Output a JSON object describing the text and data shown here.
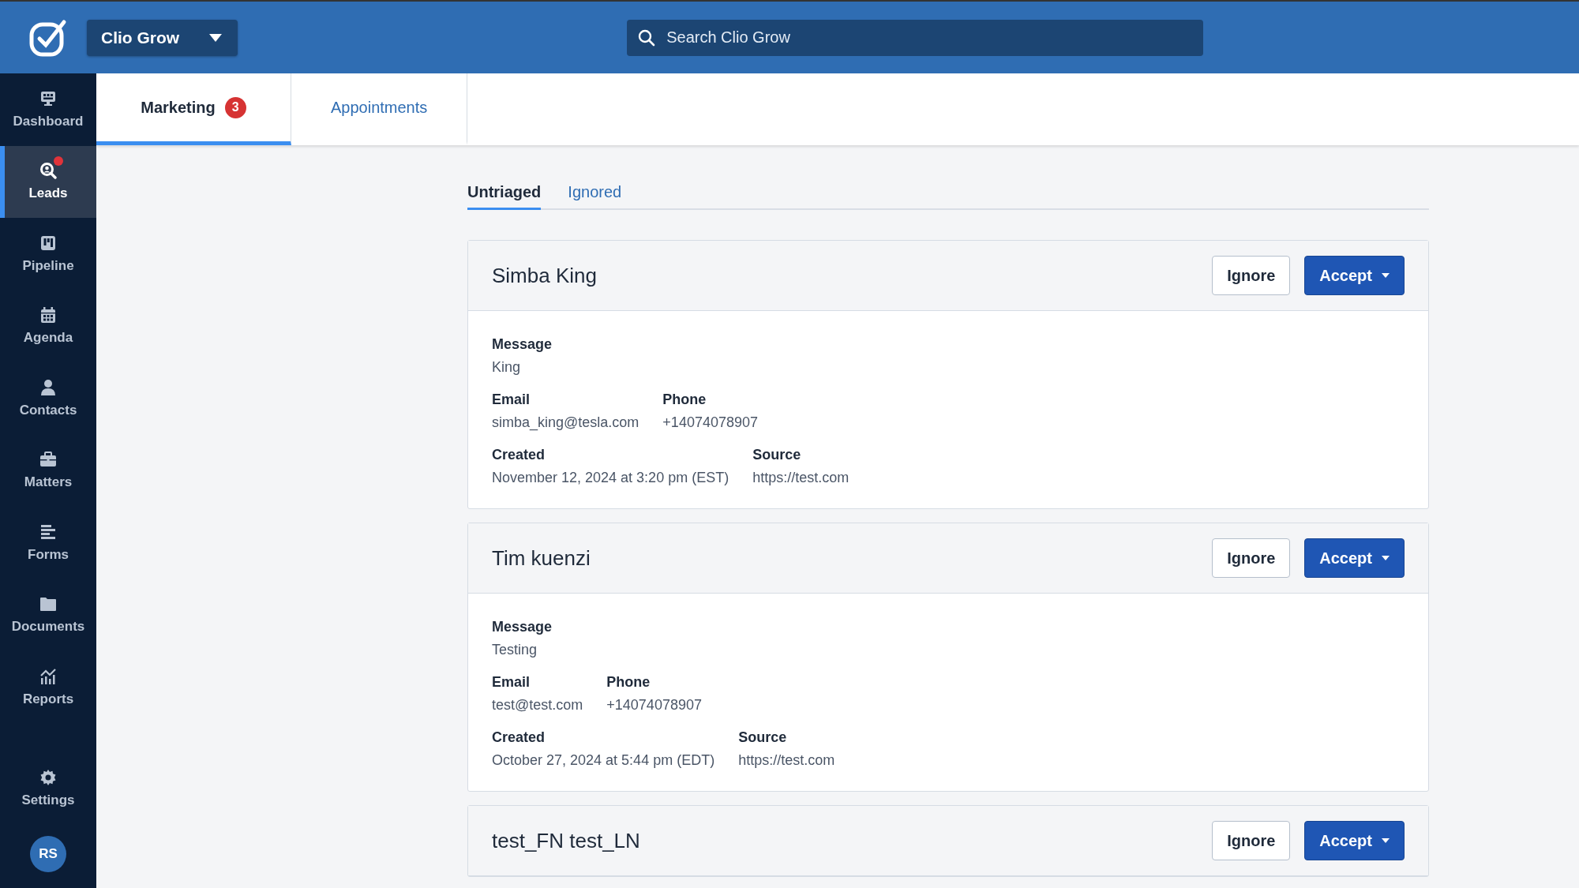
{
  "app": {
    "name": "Clio Grow"
  },
  "search": {
    "placeholder": "Search Clio Grow"
  },
  "sidebar": {
    "items": [
      {
        "label": "Dashboard",
        "selected": false,
        "alert": false
      },
      {
        "label": "Leads",
        "selected": true,
        "alert": true
      },
      {
        "label": "Pipeline",
        "selected": false,
        "alert": false
      },
      {
        "label": "Agenda",
        "selected": false,
        "alert": false
      },
      {
        "label": "Contacts",
        "selected": false,
        "alert": false
      },
      {
        "label": "Matters",
        "selected": false,
        "alert": false
      },
      {
        "label": "Forms",
        "selected": false,
        "alert": false
      },
      {
        "label": "Documents",
        "selected": false,
        "alert": false
      },
      {
        "label": "Reports",
        "selected": false,
        "alert": false
      }
    ],
    "settings": {
      "label": "Settings"
    },
    "avatar": {
      "initials": "RS"
    }
  },
  "tabs": [
    {
      "label": "Marketing",
      "badge": "3",
      "selected": true
    },
    {
      "label": "Appointments",
      "selected": false
    }
  ],
  "subtabs": [
    {
      "label": "Untriaged",
      "selected": true
    },
    {
      "label": "Ignored",
      "selected": false
    }
  ],
  "leads": [
    {
      "name": "Simba King",
      "buttons": [
        "Ignore",
        "Accept"
      ],
      "rows": [
        [
          {
            "label": "Message",
            "value": "King"
          }
        ],
        [
          {
            "label": "Email",
            "value": "simba_king@tesla.com"
          },
          {
            "label": "Phone",
            "value": "+14074078907"
          }
        ],
        [
          {
            "label": "Created",
            "value": "November 12, 2024 at 3:20 pm (EST)"
          },
          {
            "label": "Source",
            "value": "https://test.com"
          }
        ]
      ]
    },
    {
      "name": "Tim kuenzi",
      "buttons": [
        "Ignore",
        "Accept"
      ],
      "rows": [
        [
          {
            "label": "Message",
            "value": "Testing"
          }
        ],
        [
          {
            "label": "Email",
            "value": "test@test.com"
          },
          {
            "label": "Phone",
            "value": "+14074078907"
          }
        ],
        [
          {
            "label": "Created",
            "value": "October 27, 2024 at 5:44 pm (EDT)"
          },
          {
            "label": "Source",
            "value": "https://test.com"
          }
        ]
      ]
    },
    {
      "name": "test_FN test_LN",
      "buttons": [
        "Ignore",
        "Accept"
      ]
    }
  ]
}
